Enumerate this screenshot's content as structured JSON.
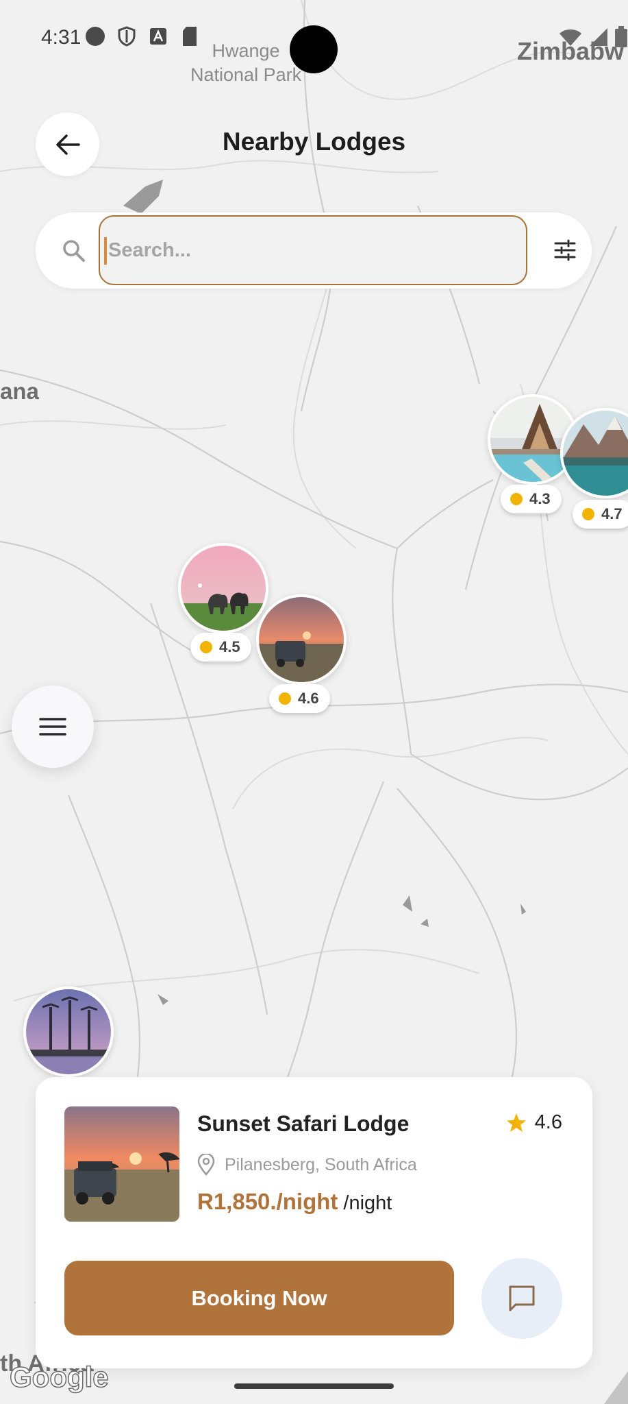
{
  "status_bar": {
    "time": "4:31",
    "icons": [
      "circle-icon",
      "shield-icon",
      "text-a-icon",
      "sd-card-icon",
      "wifi-icon",
      "signal-icon",
      "battery-icon"
    ]
  },
  "map": {
    "labels": {
      "park": "Hwange\nNational Park",
      "country_ne": "Zimbabw",
      "country_w": "ana",
      "country_s": "th Africa"
    },
    "attribution": "Google"
  },
  "header": {
    "title": "Nearby Lodges",
    "back_icon": "arrow-left-icon"
  },
  "search": {
    "placeholder": "Search...",
    "value": "",
    "filter_icon": "sliders-icon"
  },
  "markers": [
    {
      "rating": "4.3",
      "image": "cabin-pool"
    },
    {
      "rating": "4.7",
      "image": "lake-mountains"
    },
    {
      "rating": "4.5",
      "image": "elephants-pink-sky"
    },
    {
      "rating": "4.6",
      "image": "safari-jeep-sunset"
    },
    {
      "rating": "",
      "image": "palm-resort"
    }
  ],
  "menu_button": {
    "icon": "menu-icon"
  },
  "card": {
    "name": "Sunset Safari Lodge",
    "rating": "4.6",
    "location": "Pilanesberg, South Africa",
    "price": "R1,850./night",
    "price_unit": "/night",
    "book_label": "Booking Now",
    "chat_icon": "chat-icon"
  },
  "colors": {
    "accent": "#b0733c",
    "star": "#f0b400",
    "map_bg": "#f1f1f1",
    "chat_bg": "#e8eef8"
  }
}
